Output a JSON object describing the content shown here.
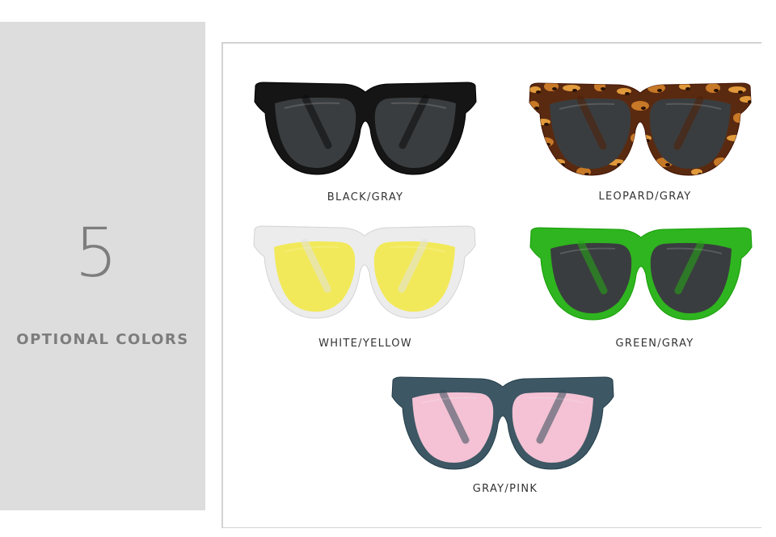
{
  "side": {
    "count": "5",
    "caption": "OPTIONAL COLORS"
  },
  "products": [
    {
      "label": "BLACK/GRAY",
      "frame_color": "#151515",
      "lens_color": "#3a3d3f",
      "pattern": "solid"
    },
    {
      "label": "LEOPARD/GRAY",
      "frame_color": "#5a2a10",
      "lens_color": "#3a3d3f",
      "pattern": "leopard"
    },
    {
      "label": "WHITE/YELLOW",
      "frame_color": "#ececec",
      "lens_color": "#f2e95a",
      "pattern": "solid"
    },
    {
      "label": "GREEN/GRAY",
      "frame_color": "#2fb51f",
      "lens_color": "#3a3d3f",
      "pattern": "solid"
    },
    {
      "label": "GRAY/PINK",
      "frame_color": "#3e5764",
      "lens_color": "#f4c2d4",
      "pattern": "solid"
    }
  ]
}
